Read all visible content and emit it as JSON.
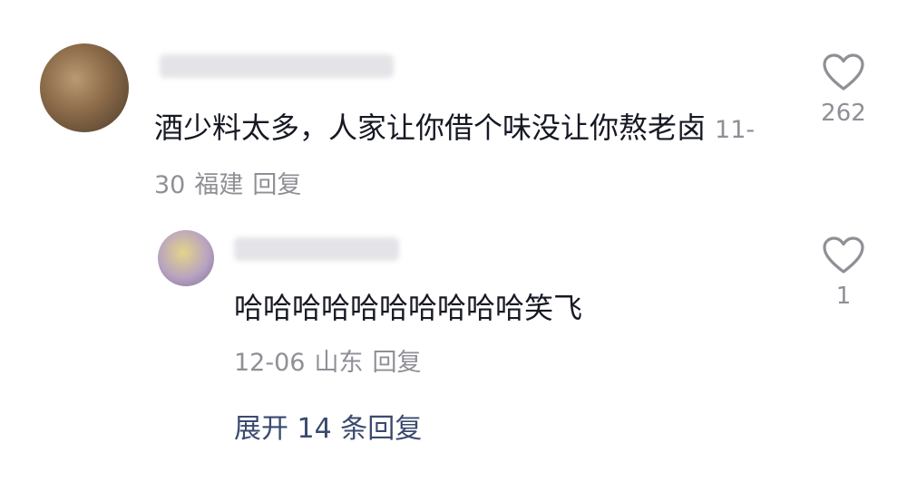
{
  "main_comment": {
    "text": "酒少料太多，人家让你借个味没让你熬老卤",
    "date": "11-30",
    "location": "福建",
    "reply_label": "回复",
    "likes": "262",
    "like_icon": "heart-outline-icon"
  },
  "reply_comment": {
    "text": "哈哈哈哈哈哈哈哈哈哈笑飞",
    "date": "12-06",
    "location": "山东",
    "reply_label": "回复",
    "likes": "1",
    "like_icon": "heart-outline-icon"
  },
  "expand_replies_label": "展开 14 条回复",
  "colors": {
    "text_primary": "#161823",
    "text_secondary": "#8f8f96",
    "link": "#3a4a6e"
  }
}
